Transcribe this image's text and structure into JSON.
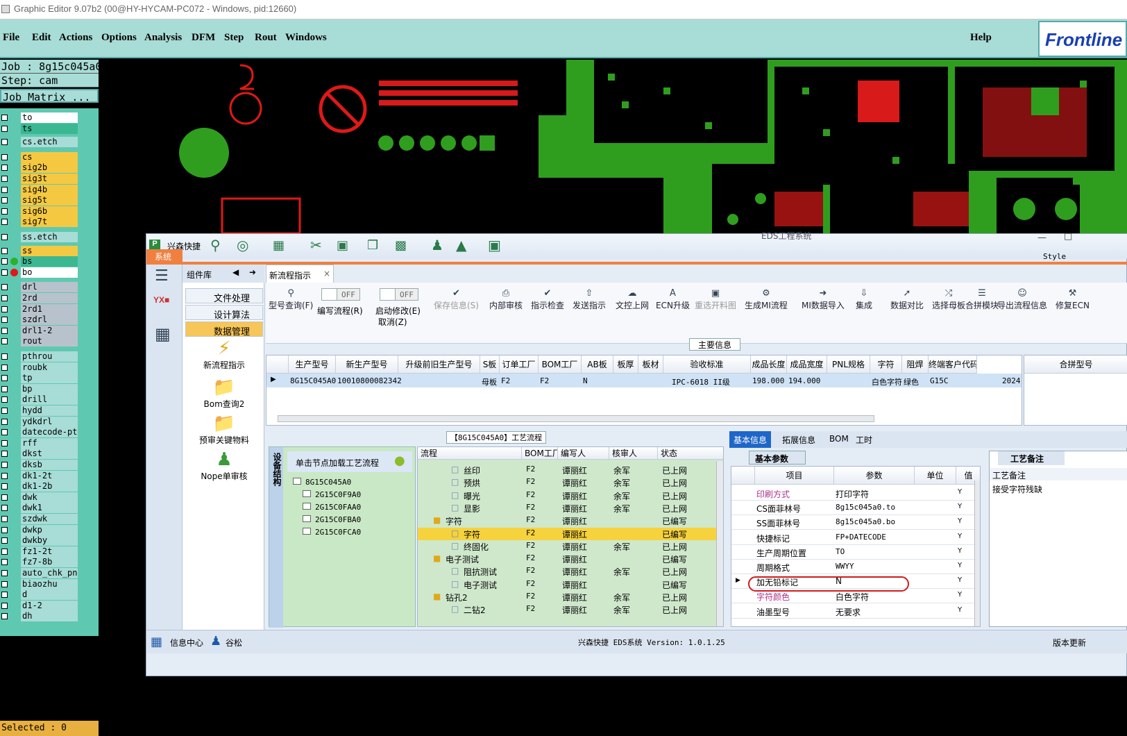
{
  "window": {
    "title": "Graphic Editor 9.07b2 (00@HY-HYCAM-PC072 - Windows, pid:12660)"
  },
  "menu": {
    "file": "File",
    "edit": "Edit",
    "actions": "Actions",
    "options": "Options",
    "analysis": "Analysis",
    "dfm": "DFM",
    "step": "Step",
    "rout": "Rout",
    "windows": "Windows",
    "help": "Help",
    "logo": "Frontline"
  },
  "job": {
    "job": "Job : 8g15c045a0",
    "step": "Step: cam",
    "matrix": "Job Matrix ..."
  },
  "layers": [
    "to",
    "ts",
    "cs.etch",
    "cs",
    "sig2b",
    "sig3t",
    "sig4b",
    "sig5t",
    "sig6b",
    "sig7t",
    "ss.etch",
    "ss",
    "bs",
    "bo",
    "drl",
    "2rd",
    "2rd1",
    "szdrl",
    "drl1-2",
    "rout",
    "pthrou",
    "roubk",
    "tp",
    "bp",
    "drill",
    "hydd",
    "ydkdrl",
    "datecode-pt",
    "rff",
    "dkst",
    "dksb",
    "dk1-2t",
    "dk1-2b",
    "dwk",
    "dwk1",
    "szdwk",
    "dwkp",
    "dwkby",
    "fz1-2t",
    "fz7-8b",
    "auto_chk_pn",
    "biaozhu",
    "d",
    "d1-2",
    "dh"
  ],
  "selected": "Selected : 0",
  "eds": {
    "app": "兴森快捷",
    "title": "EDS工程系统",
    "sys_tab": "系统",
    "style": "Style",
    "side_header": "组件库",
    "side_items": [
      "文件处理",
      "设计算法",
      "数据管理"
    ],
    "side_big": [
      "新流程指示",
      "Bom查询2",
      "预审关键物料",
      "Nope单审核"
    ],
    "doc_tab": "新流程指示",
    "ribbon": [
      "型号查询(F)",
      "编写流程(R)",
      "启动修改(E)",
      "取消(Z)",
      "保存信息(S)",
      "内部审核",
      "指示检查",
      "发送指示",
      "文控上网",
      "ECN升级",
      "重选开料图",
      "生成MI流程",
      "MI数据导入",
      "集成",
      "数据对比",
      "选择母板",
      "合拼模块",
      "导出流程信息",
      "修复ECN"
    ],
    "toggle_off": "OFF",
    "main_info": "主要信息",
    "grid_headers": [
      "生产型号",
      "新生产型号",
      "升级前旧生产型号",
      "S板",
      "订单工厂",
      "BOM工厂",
      "AB板",
      "板厚",
      "板材",
      "验收标准",
      "成品长度",
      "成品宽度",
      "PNL规格",
      "字符",
      "阻焊",
      "终端客户代码"
    ],
    "grid_row": [
      "8G15C045A0",
      "10010800082342",
      "",
      "母板",
      "F2",
      "F2",
      "N",
      "",
      "",
      "IPC-6018 II级",
      "198.000",
      "194.000",
      "",
      "白色字符",
      "绿色",
      "G15C",
      "2024"
    ],
    "merge_header": "合拼型号",
    "flow_title": "【8G15C045A0】工艺流程",
    "device_label": "设备结构",
    "flow_hint": "单击节点加载工艺流程",
    "tree": [
      "8G15C045A0",
      "2G15C0F9A0",
      "2G15C0FAA0",
      "2G15C0FBA0",
      "2G15C0FCA0"
    ],
    "flow_headers": [
      "流程",
      "BOM工厂",
      "编写人",
      "核审人",
      "状态"
    ],
    "flow_rows": [
      [
        "丝印",
        "F2",
        "谭丽红",
        "余军",
        "已上网"
      ],
      [
        "预烘",
        "F2",
        "谭丽红",
        "余军",
        "已上网"
      ],
      [
        "曝光",
        "F2",
        "谭丽红",
        "余军",
        "已上网"
      ],
      [
        "显影",
        "F2",
        "谭丽红",
        "余军",
        "已上网"
      ],
      [
        "字符",
        "F2",
        "谭丽红",
        "",
        "已编写"
      ],
      [
        "字符",
        "F2",
        "谭丽红",
        "",
        "已编写"
      ],
      [
        "终固化",
        "F2",
        "谭丽红",
        "余军",
        "已上网"
      ],
      [
        "电子测试",
        "F2",
        "谭丽红",
        "",
        "已编写"
      ],
      [
        "阻抗测试",
        "F2",
        "谭丽红",
        "余军",
        "已上网"
      ],
      [
        "电子测试",
        "F2",
        "谭丽红",
        "",
        "已编写"
      ],
      [
        "钻孔2",
        "F2",
        "谭丽红",
        "余军",
        "已上网"
      ],
      [
        "二钻2",
        "F2",
        "谭丽红",
        "余军",
        "已上网"
      ]
    ],
    "info_tabs": [
      "基本信息",
      "拓展信息",
      "BOM",
      "工时"
    ],
    "basic_params": "基本参数",
    "param_headers": [
      "项目",
      "参数",
      "单位",
      "值"
    ],
    "params": [
      [
        "印刷方式",
        "打印字符",
        "Y"
      ],
      [
        "CS面菲林号",
        "8g15c045a0.to",
        "Y"
      ],
      [
        "SS面菲林号",
        "8g15c045a0.bo",
        "Y"
      ],
      [
        "快捷标记",
        "FP+DATECODE",
        "Y"
      ],
      [
        "生产周期位置",
        "TO",
        "Y"
      ],
      [
        "周期格式",
        "WWYY",
        "Y"
      ],
      [
        "加无铅标记",
        "N",
        "Y"
      ],
      [
        "字符颜色",
        "白色字符",
        "Y"
      ],
      [
        "油墨型号",
        "无要求",
        "Y"
      ]
    ],
    "remark_tab": "工艺备注",
    "remark_label": "工艺备注",
    "remark_text": "接受字符残缺",
    "status_center": "信息中心",
    "status_user": "谷松",
    "status_version": "兴森快捷 EDS系统 Version: 1.0.1.25",
    "status_update": "版本更新"
  }
}
